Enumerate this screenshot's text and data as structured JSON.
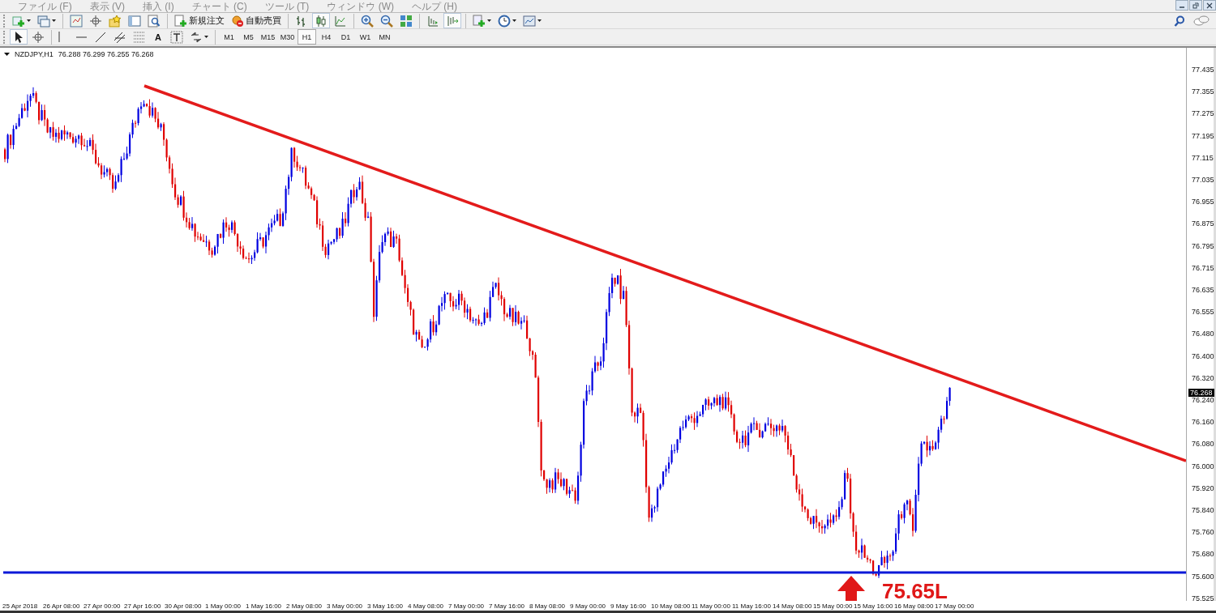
{
  "menu": [
    "ファイル (F)",
    "表示 (V)",
    "挿入 (I)",
    "チャート (C)",
    "ツール (T)",
    "ウィンドウ (W)",
    "ヘルプ (H)"
  ],
  "toolbar_main": [
    {
      "kind": "new_chart",
      "dropdown": true,
      "selected": false
    },
    {
      "kind": "profiles",
      "dropdown": true,
      "selected": false
    },
    {
      "kind": "separator"
    },
    {
      "kind": "market_watch",
      "selected": false
    },
    {
      "kind": "navigator",
      "selected": false
    },
    {
      "kind": "favorites",
      "selected": false
    },
    {
      "kind": "terminal",
      "selected": false
    },
    {
      "kind": "tester",
      "selected": false
    },
    {
      "kind": "separator"
    },
    {
      "kind": "new_order",
      "label": "新規注文",
      "selected": false
    },
    {
      "kind": "auto_trading",
      "label": "自動売買",
      "selected": false
    },
    {
      "kind": "separator"
    },
    {
      "kind": "bar_chart",
      "selected": false
    },
    {
      "kind": "candle_chart",
      "selected": true
    },
    {
      "kind": "line_chart",
      "selected": false
    },
    {
      "kind": "separator"
    },
    {
      "kind": "zoom_in",
      "selected": false
    },
    {
      "kind": "zoom_out",
      "selected": false
    },
    {
      "kind": "tile",
      "selected": false
    },
    {
      "kind": "separator"
    },
    {
      "kind": "chart_shift",
      "selected": false
    },
    {
      "kind": "auto_scroll",
      "selected": true
    },
    {
      "kind": "separator"
    },
    {
      "kind": "indicators",
      "dropdown": true,
      "selected": false
    },
    {
      "kind": "periods",
      "dropdown": true,
      "selected": false
    },
    {
      "kind": "templates",
      "dropdown": true,
      "selected": false
    }
  ],
  "toolbar_draw": [
    {
      "kind": "cursor",
      "selected": true
    },
    {
      "kind": "crosshair",
      "selected": false
    },
    {
      "kind": "separator"
    },
    {
      "kind": "vertical_line",
      "selected": false
    },
    {
      "kind": "horizontal_line",
      "selected": false
    },
    {
      "kind": "trend_line",
      "selected": false
    },
    {
      "kind": "channel",
      "selected": false
    },
    {
      "kind": "fibonacci",
      "selected": false
    },
    {
      "kind": "text",
      "label": "A",
      "selected": false
    },
    {
      "kind": "text_label",
      "selected": false
    },
    {
      "kind": "arrows",
      "dropdown": true,
      "selected": false
    }
  ],
  "timeframes": [
    {
      "label": "M1",
      "selected": false
    },
    {
      "label": "M5",
      "selected": false
    },
    {
      "label": "M15",
      "selected": false
    },
    {
      "label": "M30",
      "selected": false
    },
    {
      "label": "H1",
      "selected": true
    },
    {
      "label": "H4",
      "selected": false
    },
    {
      "label": "D1",
      "selected": false
    },
    {
      "label": "W1",
      "selected": false
    },
    {
      "label": "MN",
      "selected": false
    }
  ],
  "chart": {
    "symbol": "NZDJPY,H1",
    "ohlc": "76.288 76.299 76.255 76.268",
    "current_price": "76.268",
    "annotation": "75.65L",
    "price_labels": [
      "77.435",
      "77.355",
      "77.275",
      "77.195",
      "77.115",
      "77.035",
      "76.955",
      "76.875",
      "76.795",
      "76.715",
      "76.635",
      "76.555",
      "76.480",
      "76.400",
      "76.320",
      "76.240",
      "76.160",
      "76.080",
      "76.000",
      "75.920",
      "75.840",
      "75.760",
      "75.680",
      "75.600",
      "75.525"
    ],
    "time_labels": [
      "25 Apr 2018",
      "26 Apr 08:00",
      "27 Apr 00:00",
      "27 Apr 16:00",
      "30 Apr 08:00",
      "1 May 00:00",
      "1 May 16:00",
      "2 May 08:00",
      "3 May 00:00",
      "3 May 16:00",
      "4 May 08:00",
      "7 May 00:00",
      "7 May 16:00",
      "8 May 08:00",
      "9 May 00:00",
      "9 May 16:00",
      "10 May 08:00",
      "11 May 00:00",
      "11 May 16:00",
      "14 May 08:00",
      "15 May 00:00",
      "15 May 16:00",
      "16 May 08:00",
      "17 May 00:00"
    ]
  }
}
